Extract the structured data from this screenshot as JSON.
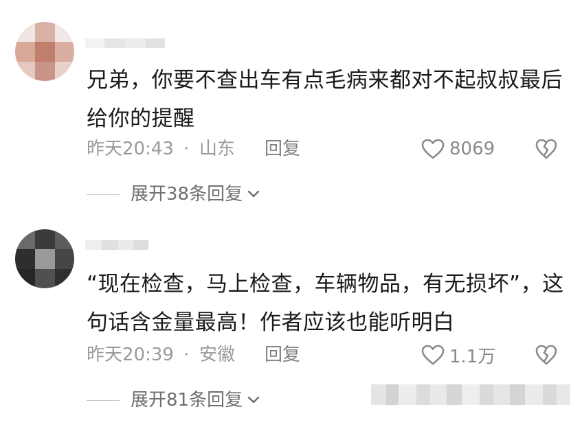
{
  "comments": [
    {
      "text": "兄弟，你要不查出车有点毛病来都对不起叔叔最后给你的提醒",
      "time": "昨天20:43",
      "dot": "·",
      "location": "山东",
      "reply_label": "回复",
      "likes": "8069",
      "expand_label": "展开38条回复",
      "icons": {
        "like": "heart-outline-icon",
        "dislike": "broken-heart-icon",
        "expand": "chevron-down-icon"
      }
    },
    {
      "text": "“现在检查，马上检查，车辆物品，有无损坏”，这句话含金量最高！作者应该也能听明白",
      "time": "昨天20:39",
      "dot": "·",
      "location": "安徽",
      "reply_label": "回复",
      "likes": "1.1万",
      "expand_label": "展开81条回复",
      "icons": {
        "like": "heart-outline-icon",
        "dislike": "broken-heart-icon",
        "expand": "chevron-down-icon"
      }
    }
  ],
  "colors": {
    "text": "#1a1a1a",
    "meta": "#9a9a9a",
    "expand": "#6e6e6e",
    "background": "#ffffff"
  }
}
